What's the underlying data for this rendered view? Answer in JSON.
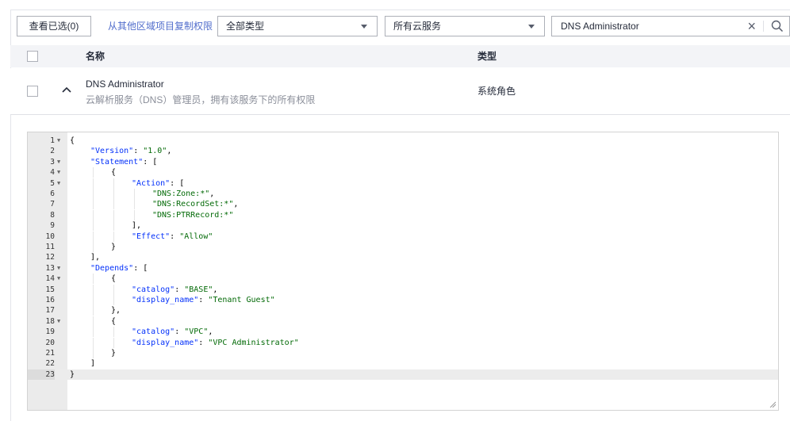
{
  "toolbar": {
    "selected_button": "查看已选(0)",
    "copy_link": "从其他区域项目复制权限",
    "type_select": "全部类型",
    "service_select": "所有云服务",
    "search_value": "DNS Administrator",
    "clear_icon": "×"
  },
  "table": {
    "headers": {
      "name": "名称",
      "type": "类型"
    },
    "rows": [
      {
        "name": "DNS Administrator",
        "description": "云解析服务（DNS）管理员，拥有该服务下的所有权限",
        "type": "系统角色"
      }
    ]
  },
  "colors": {
    "link": "#526ecc",
    "key": "#0431fa",
    "string": "#036a07"
  },
  "code": {
    "lines": [
      {
        "n": "1",
        "fold": true,
        "indent": 0,
        "parts": [
          [
            "p",
            "{"
          ]
        ]
      },
      {
        "n": "2",
        "fold": false,
        "indent": 1,
        "parts": [
          [
            "k",
            "\"Version\""
          ],
          [
            "p",
            ": "
          ],
          [
            "s",
            "\"1.0\""
          ],
          [
            "p",
            ","
          ]
        ]
      },
      {
        "n": "3",
        "fold": true,
        "indent": 1,
        "parts": [
          [
            "k",
            "\"Statement\""
          ],
          [
            "p",
            ": ["
          ]
        ]
      },
      {
        "n": "4",
        "fold": true,
        "indent": 2,
        "parts": [
          [
            "p",
            "{"
          ]
        ]
      },
      {
        "n": "5",
        "fold": true,
        "indent": 3,
        "parts": [
          [
            "k",
            "\"Action\""
          ],
          [
            "p",
            ": ["
          ]
        ]
      },
      {
        "n": "6",
        "fold": false,
        "indent": 4,
        "parts": [
          [
            "s",
            "\"DNS:Zone:*\""
          ],
          [
            "p",
            ","
          ]
        ]
      },
      {
        "n": "7",
        "fold": false,
        "indent": 4,
        "parts": [
          [
            "s",
            "\"DNS:RecordSet:*\""
          ],
          [
            "p",
            ","
          ]
        ]
      },
      {
        "n": "8",
        "fold": false,
        "indent": 4,
        "parts": [
          [
            "s",
            "\"DNS:PTRRecord:*\""
          ]
        ]
      },
      {
        "n": "9",
        "fold": false,
        "indent": 3,
        "parts": [
          [
            "p",
            "],"
          ]
        ]
      },
      {
        "n": "10",
        "fold": false,
        "indent": 3,
        "parts": [
          [
            "k",
            "\"Effect\""
          ],
          [
            "p",
            ": "
          ],
          [
            "s",
            "\"Allow\""
          ]
        ]
      },
      {
        "n": "11",
        "fold": false,
        "indent": 2,
        "parts": [
          [
            "p",
            "}"
          ]
        ]
      },
      {
        "n": "12",
        "fold": false,
        "indent": 1,
        "parts": [
          [
            "p",
            "],"
          ]
        ]
      },
      {
        "n": "13",
        "fold": true,
        "indent": 1,
        "parts": [
          [
            "k",
            "\"Depends\""
          ],
          [
            "p",
            ": ["
          ]
        ]
      },
      {
        "n": "14",
        "fold": true,
        "indent": 2,
        "parts": [
          [
            "p",
            "{"
          ]
        ]
      },
      {
        "n": "15",
        "fold": false,
        "indent": 3,
        "parts": [
          [
            "k",
            "\"catalog\""
          ],
          [
            "p",
            ": "
          ],
          [
            "s",
            "\"BASE\""
          ],
          [
            "p",
            ","
          ]
        ]
      },
      {
        "n": "16",
        "fold": false,
        "indent": 3,
        "parts": [
          [
            "k",
            "\"display_name\""
          ],
          [
            "p",
            ": "
          ],
          [
            "s",
            "\"Tenant Guest\""
          ]
        ]
      },
      {
        "n": "17",
        "fold": false,
        "indent": 2,
        "parts": [
          [
            "p",
            "},"
          ]
        ]
      },
      {
        "n": "18",
        "fold": true,
        "indent": 2,
        "parts": [
          [
            "p",
            "{"
          ]
        ]
      },
      {
        "n": "19",
        "fold": false,
        "indent": 3,
        "parts": [
          [
            "k",
            "\"catalog\""
          ],
          [
            "p",
            ": "
          ],
          [
            "s",
            "\"VPC\""
          ],
          [
            "p",
            ","
          ]
        ]
      },
      {
        "n": "20",
        "fold": false,
        "indent": 3,
        "parts": [
          [
            "k",
            "\"display_name\""
          ],
          [
            "p",
            ": "
          ],
          [
            "s",
            "\"VPC Administrator\""
          ]
        ]
      },
      {
        "n": "21",
        "fold": false,
        "indent": 2,
        "parts": [
          [
            "p",
            "}"
          ]
        ]
      },
      {
        "n": "22",
        "fold": false,
        "indent": 1,
        "parts": [
          [
            "p",
            "]"
          ]
        ]
      },
      {
        "n": "23",
        "fold": false,
        "indent": 0,
        "parts": [
          [
            "p",
            "}"
          ]
        ],
        "active": true
      }
    ]
  }
}
